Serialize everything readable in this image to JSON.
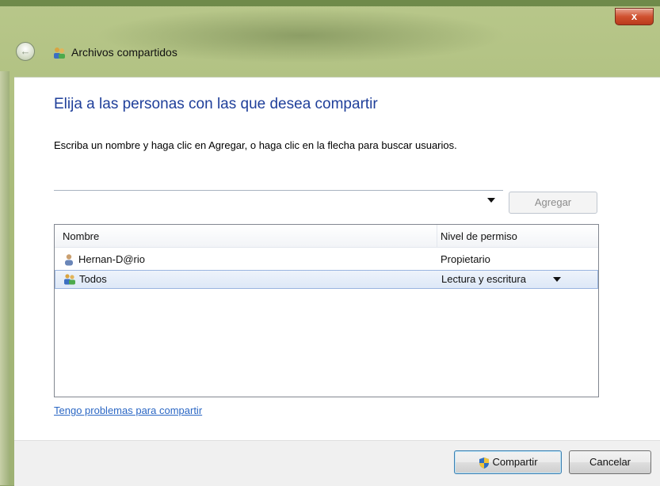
{
  "window": {
    "title": "Archivos compartidos",
    "close_label": "x"
  },
  "main": {
    "heading": "Elija a las personas con las que desea compartir",
    "instruction": "Escriba un nombre y haga clic en Agregar, o haga clic en la flecha para buscar usuarios.",
    "name_input_value": "",
    "add_button": "Agregar",
    "list": {
      "columns": [
        "Nombre",
        "Nivel de permiso"
      ],
      "rows": [
        {
          "name": "Hernan-D@rio",
          "permission": "Propietario",
          "icon": "user-icon"
        },
        {
          "name": "Todos",
          "permission": "Lectura y escritura",
          "icon": "users-group-icon",
          "selected": true
        }
      ]
    },
    "help_link": "Tengo problemas para compartir"
  },
  "footer": {
    "share_button": "Compartir",
    "cancel_button": "Cancelar"
  },
  "colors": {
    "heading": "#1f3f9a",
    "link": "#2b67c4",
    "selection": "#dde8f7"
  }
}
